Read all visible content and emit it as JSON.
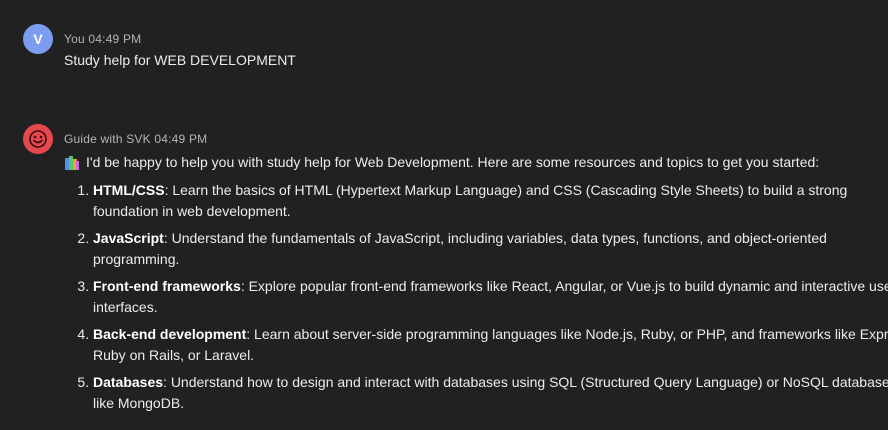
{
  "user_message": {
    "avatar_letter": "V",
    "author": "You",
    "time": "04:49 PM",
    "text": "Study help for WEB DEVELOPMENT"
  },
  "bot_message": {
    "avatar_icon": "smiley-face-icon",
    "author": "Guide with SVK",
    "time": "04:49 PM",
    "intro_icon": "books-icon",
    "intro": "I'd be happy to help you with study help for Web Development. Here are some resources and topics to get you started:",
    "items": [
      {
        "title": "HTML/CSS",
        "text": ": Learn the basics of HTML (Hypertext Markup Language) and CSS (Cascading Style Sheets) to build a strong foundation in web development."
      },
      {
        "title": "JavaScript",
        "text": ": Understand the fundamentals of JavaScript, including variables, data types, functions, and object-oriented programming."
      },
      {
        "title": "Front-end frameworks",
        "text": ": Explore popular front-end frameworks like React, Angular, or Vue.js to build dynamic and interactive user interfaces."
      },
      {
        "title": "Back-end development",
        "text": ": Learn about server-side programming languages like Node.js, Ruby, or PHP, and frameworks like Express, Ruby on Rails, or Laravel."
      },
      {
        "title": "Databases",
        "text": ": Understand how to design and interact with databases using SQL (Structured Query Language) or NoSQL databases like MongoDB."
      }
    ]
  },
  "colors": {
    "background": "#212121",
    "user_avatar": "#7c9cf0",
    "bot_avatar": "#e5484d",
    "meta_text": "#b4b4b4",
    "body_text": "#ececec"
  }
}
